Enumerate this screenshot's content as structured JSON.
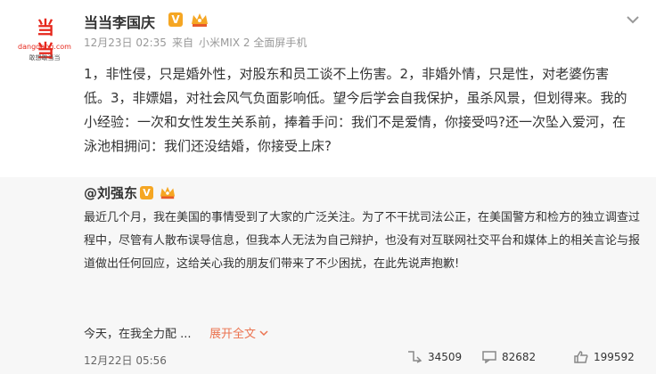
{
  "post": {
    "avatar": {
      "logo_text": "当当",
      "domain": "dangdang.com",
      "subtitle": "敢想敢当当"
    },
    "author": "当当李国庆",
    "verified": "V",
    "meta": {
      "time": "12月23日 02:35",
      "source": "来自",
      "device": "小米MIX 2 全面屏手机"
    },
    "text": "1，非性侵，只是婚外性，对股东和员工谈不上伤害。2，非婚外情，只是性，对老婆伤害低。3，非嫖娼，对社会风气负面影响低。望今后学会自我保护，虽杀风景，但划得来。我的小经验：一次和女性发生关系前，捧着手问：我们不是爱情，你接受吗?还一次坠入爱河，在泳池相拥问：我们还没结婚，你接受上床?"
  },
  "repost": {
    "author": "@刘强东",
    "verified": "V",
    "text": "最近几个月，我在美国的事情受到了大家的广泛关注。为了不干扰司法公正，在美国警方和检方的独立调查过程中，尽管有人散布误导信息，但我本人无法为自己辩护，也没有对互联网社交平台和媒体上的相关言论与报道做出任何回应，这给关心我的朋友们带来了不少困扰，在此先说声抱歉!",
    "teaser": "今天，在我全力配 ...",
    "expand_label": "展开全文",
    "date": "12月22日 05:56",
    "stats": {
      "reposts": "34509",
      "comments": "82682",
      "likes": "199592"
    }
  },
  "colors": {
    "brand_red": "#e6271c",
    "badge_orange": "#f5a623",
    "link_orange": "#eb7350",
    "repost_bg": "#f7f7f7"
  },
  "icons": [
    "chevron-down-icon",
    "verified-badge-icon",
    "member-crown-icon",
    "repost-icon",
    "comment-icon",
    "like-icon"
  ]
}
